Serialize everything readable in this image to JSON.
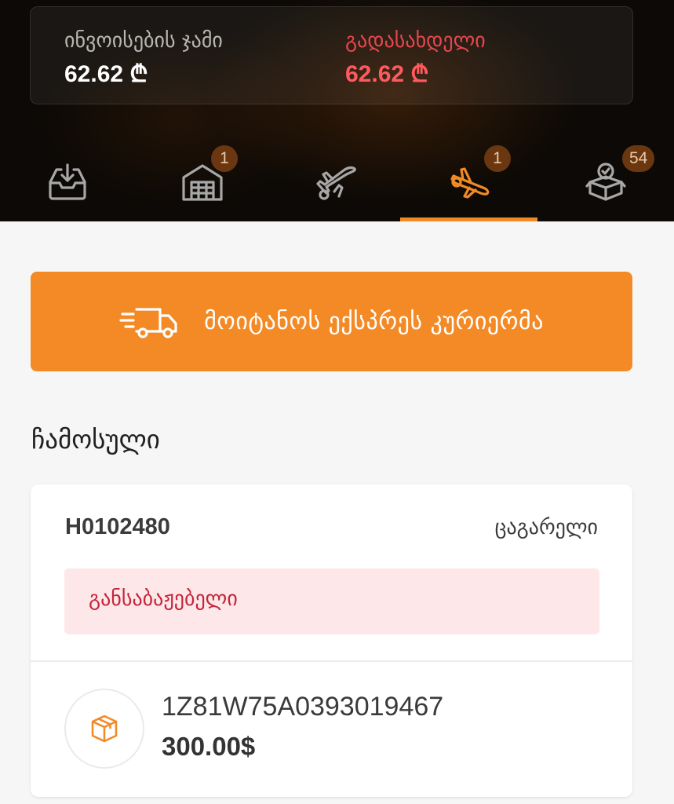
{
  "summary": {
    "invoice_total_label": "ინვოისების ჯამი",
    "invoice_total_value": "62.62 ₾",
    "payable_label": "გადასახდელი",
    "payable_value": "62.62 ₾"
  },
  "tabs": [
    {
      "icon": "inbox-download-icon",
      "badge": null,
      "active": false
    },
    {
      "icon": "warehouse-icon",
      "badge": "1",
      "active": false
    },
    {
      "icon": "airplane-takeoff-icon",
      "badge": null,
      "active": false
    },
    {
      "icon": "airplane-landing-icon",
      "badge": "1",
      "active": true
    },
    {
      "icon": "delivered-box-icon",
      "badge": "54",
      "active": false
    }
  ],
  "courier_button": {
    "label": "მოიტანოს ექსპრეს კურიერმა",
    "icon": "fast-truck-icon"
  },
  "section": {
    "title": "ჩამოსული"
  },
  "parcel": {
    "code": "H0102480",
    "sender": "ცაგარელი",
    "status": "განსაბაჟებელი",
    "items": [
      {
        "icon": "package-icon",
        "tracking": "1Z81W75A0393019467",
        "price": "300.00$"
      }
    ]
  },
  "colors": {
    "accent": "#f38a26",
    "debt": "#ff5a5f",
    "status_text": "#c6253a",
    "status_bg": "#fde7e9",
    "badge_bg": "#6a3711"
  }
}
